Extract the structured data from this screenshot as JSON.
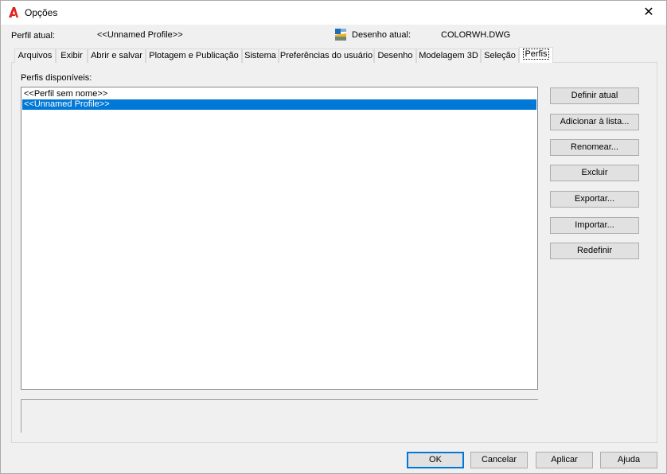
{
  "window": {
    "title": "Opções",
    "close_glyph": "✕"
  },
  "header": {
    "profile_label": "Perfil atual:",
    "profile_value": "<<Unnamed Profile>>",
    "drawing_label": "Desenho atual:",
    "drawing_value": "COLORWH.DWG"
  },
  "tabs": [
    {
      "label": "Arquivos"
    },
    {
      "label": "Exibir"
    },
    {
      "label": "Abrir e salvar"
    },
    {
      "label": "Plotagem e Publicação"
    },
    {
      "label": "Sistema"
    },
    {
      "label": "Preferências do usuário"
    },
    {
      "label": "Desenho"
    },
    {
      "label": "Modelagem 3D"
    },
    {
      "label": "Seleção"
    },
    {
      "label": "Perfis",
      "active": true
    }
  ],
  "profiles": {
    "label": "Perfis disponíveis:",
    "items": [
      {
        "label": "<<Perfil sem nome>>",
        "selected": false
      },
      {
        "label": "<<Unnamed Profile>>",
        "selected": true
      }
    ],
    "description": ""
  },
  "actions": {
    "set_current": "Definir atual",
    "add_to_list": "Adicionar à lista...",
    "rename": "Renomear...",
    "delete": "Excluir",
    "export": "Exportar...",
    "import": "Importar...",
    "reset": "Redefinir"
  },
  "footer": {
    "ok": "OK",
    "cancel": "Cancelar",
    "apply": "Aplicar",
    "help": "Ajuda"
  },
  "colors": {
    "accent": "#0078d7",
    "app_icon": "#e2231a"
  },
  "icons": {
    "app": "autocad-logo-icon",
    "drawing": "drawing-file-icon",
    "close": "close-icon"
  }
}
